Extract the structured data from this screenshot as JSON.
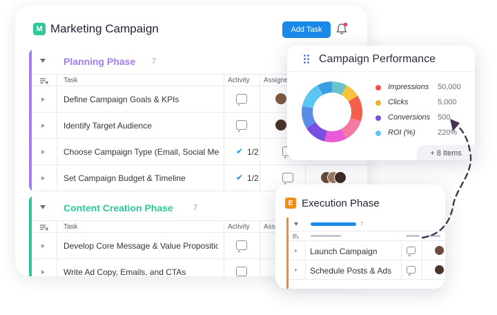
{
  "board": {
    "logo_letter": "M",
    "title": "Marketing Campaign",
    "add_task_label": "Add Task"
  },
  "groups": [
    {
      "title": "Planning Phase",
      "count": "7",
      "color": "#a27cf0",
      "columns": {
        "task": "Task",
        "activity": "Activity",
        "assignee": "Assignee"
      },
      "rows": [
        {
          "task": "Define Campaign Goals & KPIs"
        },
        {
          "task": "Identify Target Audience"
        },
        {
          "task": "Choose Campaign Type (Email, Social Media)",
          "progress": "1/2"
        },
        {
          "task": "Set Campaign Budget & Timeline",
          "progress": "1/2"
        }
      ]
    },
    {
      "title": "Content Creation Phase",
      "count": "7",
      "color": "#2cc59b",
      "columns": {
        "task": "Task",
        "activity": "Activity",
        "assignee": "Assignee"
      },
      "rows": [
        {
          "task": "Develop Core Message & Value Proposition"
        },
        {
          "task": "Write Ad Copy, Emails, and CTAs"
        }
      ]
    }
  ],
  "performance": {
    "title": "Campaign Performance",
    "metrics": [
      {
        "label": "Impressions",
        "value": "50,000",
        "color": "#f2504b"
      },
      {
        "label": "Clicks",
        "value": "5,000",
        "color": "#f2b02c"
      },
      {
        "label": "Conversions",
        "value": "500",
        "color": "#7a4fe0"
      },
      {
        "label": "ROI (%)",
        "value": "220%",
        "color": "#5cc6f2"
      }
    ],
    "donut_segments": [
      {
        "value": 8,
        "color": "#69c3c9"
      },
      {
        "value": 8,
        "color": "#f4c43a"
      },
      {
        "value": 14,
        "color": "#f2604b"
      },
      {
        "value": 12,
        "color": "#f07aa0"
      },
      {
        "value": 12,
        "color": "#e85ad6"
      },
      {
        "value": 12,
        "color": "#7a4fe0"
      },
      {
        "value": 12,
        "color": "#5a8de8"
      },
      {
        "value": 14,
        "color": "#5cc6f2"
      },
      {
        "value": 8,
        "color": "#3aa0e0"
      }
    ],
    "more_label": "+ 8 Items"
  },
  "execution": {
    "badge_letter": "E",
    "title": "Execution Phase",
    "count": "7",
    "rows": [
      {
        "task": "Launch Campaign"
      },
      {
        "task": "Schedule Posts & Ads"
      }
    ]
  }
}
